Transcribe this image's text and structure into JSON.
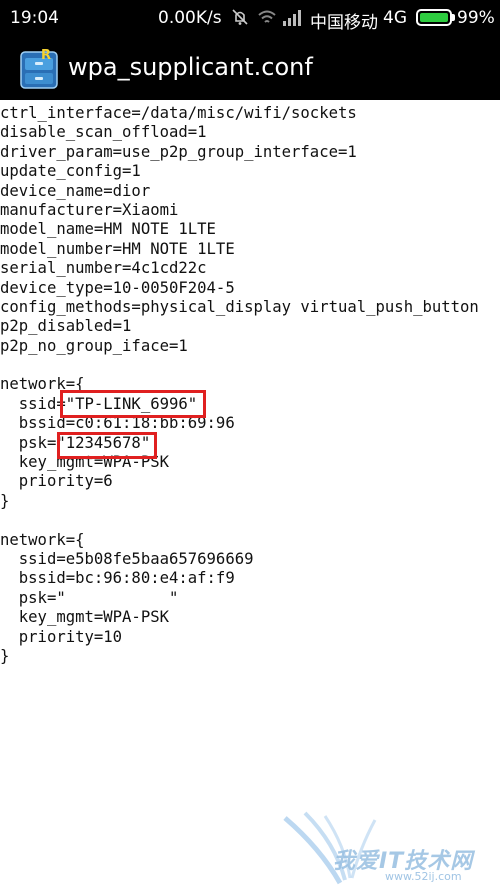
{
  "status_bar": {
    "time": "19:04",
    "net_speed": "0.00K/s",
    "carrier": "中国移动",
    "network_type": "4G",
    "battery_percent": "99%",
    "battery_level": 0.99,
    "battery_color": "#2ecc40",
    "icons": [
      "mute-icon",
      "wifi-icon",
      "signal-icon",
      "battery-icon"
    ]
  },
  "app_bar": {
    "icon": "root-explorer-app-icon",
    "title": "wpa_supplicant.conf"
  },
  "file_lines": [
    "ctrl_interface=/data/misc/wifi/sockets",
    "disable_scan_offload=1",
    "driver_param=use_p2p_group_interface=1",
    "update_config=1",
    "device_name=dior",
    "manufacturer=Xiaomi",
    "model_name=HM NOTE 1LTE",
    "model_number=HM NOTE 1LTE",
    "serial_number=4c1cd22c",
    "device_type=10-0050F204-5",
    "config_methods=physical_display virtual_push_button",
    "p2p_disabled=1",
    "p2p_no_group_iface=1",
    "",
    "network={",
    "  ssid=\"TP-LINK_6996\"",
    "  bssid=c0:61:18:bb:69:96",
    "  psk=\"12345678\"",
    "  key_mgmt=WPA-PSK",
    "  priority=6",
    "}",
    "",
    "network={",
    "  ssid=e5b08fe5baa657696669",
    "  bssid=bc:96:80:e4:af:f9",
    "  psk=\"           \"",
    "  key_mgmt=WPA-PSK",
    "  priority=10",
    "}"
  ],
  "highlight_color": "#e02020",
  "watermark": {
    "text": "我爱IT技术网",
    "url": "www.52ij.com"
  }
}
